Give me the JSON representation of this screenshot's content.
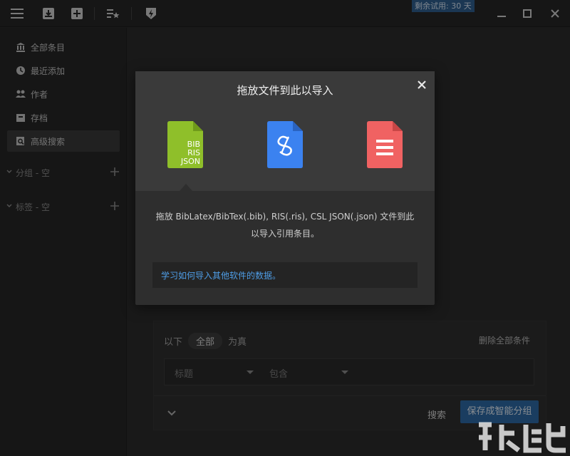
{
  "titlebar": {
    "trial_text": "剩余试用: 30 天"
  },
  "sidebar": {
    "items": [
      {
        "label": "全部条目",
        "icon": "library-icon"
      },
      {
        "label": "最近添加",
        "icon": "clock-icon"
      },
      {
        "label": "作者",
        "icon": "people-icon"
      },
      {
        "label": "存档",
        "icon": "archive-icon"
      },
      {
        "label": "高级搜索",
        "icon": "advanced-search-icon"
      }
    ],
    "groups_label": "分组 - 空",
    "tags_label": "标签 - 空"
  },
  "search_panel": {
    "prefix": "以下",
    "scope": "全部",
    "suffix": "为真",
    "delete_all": "删除全部条件",
    "field": "标题",
    "operator": "包含",
    "search_button": "搜索",
    "save_button": "保存成智能分组"
  },
  "modal": {
    "title": "拖放文件到此以导入",
    "bib_icon_lines": [
      "BIB",
      "RIS",
      "JSON"
    ],
    "description": "拖放 BibLatex/BibTex(.bib), RIS(.ris), CSL JSON(.json) 文件到此以导入引用条目。",
    "learn_link": "学习如何导入其他软件的数据。"
  },
  "colors": {
    "accent_blue": "#2d6aa6",
    "bib_green": "#8fbf2a",
    "zotero_blue": "#3b82f0",
    "pdf_red": "#f06262",
    "link_blue": "#4e9de6"
  }
}
